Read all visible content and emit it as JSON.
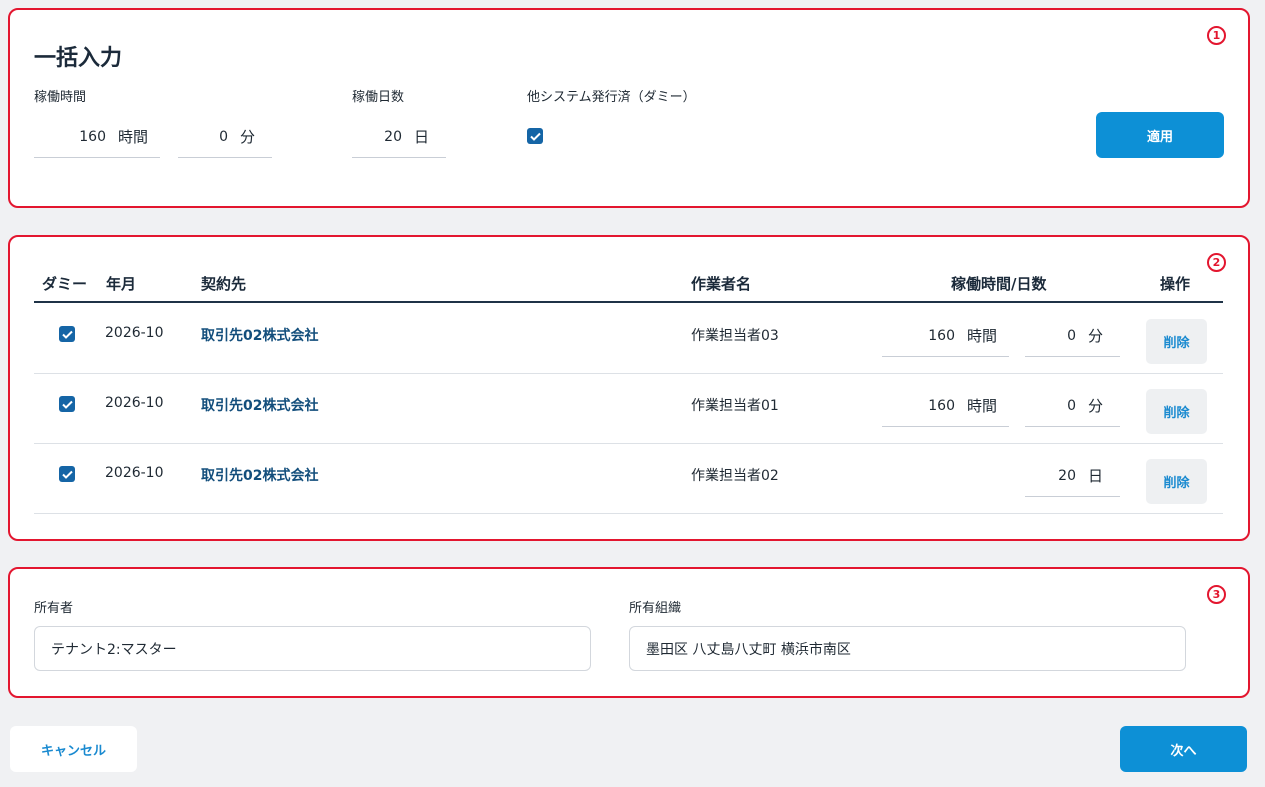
{
  "bulk": {
    "title": "一括入力",
    "hours_label": "稼働時間",
    "days_label": "稼働日数",
    "other_system_label": "他システム発行済（ダミー）",
    "hours_value": "160",
    "hours_unit": "時間",
    "minutes_value": "0",
    "minutes_unit": "分",
    "days_value": "20",
    "days_unit": "日",
    "other_system_checked": true,
    "apply_label": "適用",
    "marker": "1"
  },
  "table": {
    "marker": "2",
    "headers": {
      "dummy": "ダミー",
      "month": "年月",
      "client": "契約先",
      "worker": "作業者名",
      "work": "稼働時間/日数",
      "action": "操作"
    },
    "rows": [
      {
        "dummy_checked": true,
        "month": "2026-10",
        "client": "取引先02株式会社",
        "worker": "作業担当者03",
        "hours": "160",
        "hours_unit": "時間",
        "minutes": "0",
        "minutes_unit": "分",
        "delete_label": "削除"
      },
      {
        "dummy_checked": true,
        "month": "2026-10",
        "client": "取引先02株式会社",
        "worker": "作業担当者01",
        "hours": "160",
        "hours_unit": "時間",
        "minutes": "0",
        "minutes_unit": "分",
        "delete_label": "削除"
      },
      {
        "dummy_checked": true,
        "month": "2026-10",
        "client": "取引先02株式会社",
        "worker": "作業担当者02",
        "days": "20",
        "days_unit": "日",
        "delete_label": "削除"
      }
    ]
  },
  "owner": {
    "marker": "3",
    "owner_label": "所有者",
    "owner_value": "テナント2:マスター",
    "org_label": "所有組織",
    "org_value": "墨田区 八丈島八丈町 横浜市南区"
  },
  "footer": {
    "cancel_label": "キャンセル",
    "next_label": "次へ"
  },
  "colors": {
    "accent": "#0d90d6",
    "highlight_border": "#e3162f",
    "checkbox": "#1565a6",
    "link": "#134e7c"
  }
}
